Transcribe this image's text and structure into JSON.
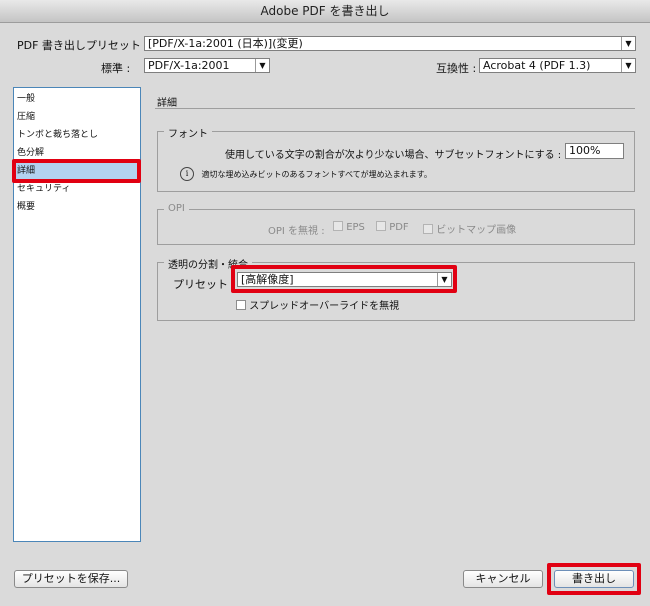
{
  "window": {
    "title": "Adobe PDF を書き出し"
  },
  "preset": {
    "label": "PDF 書き出しプリセット :",
    "value": "[PDF/X-1a:2001 (日本)](変更)"
  },
  "standard": {
    "label": "標準 :",
    "value": "PDF/X-1a:2001"
  },
  "compatibility": {
    "label": "互換性 :",
    "value": "Acrobat 4 (PDF 1.3)"
  },
  "sidebar": {
    "items": [
      {
        "label": "一般"
      },
      {
        "label": "圧縮"
      },
      {
        "label": "トンボと裁ち落とし"
      },
      {
        "label": "色分解"
      },
      {
        "label": "詳細",
        "selected": true
      },
      {
        "label": "セキュリティ"
      },
      {
        "label": "概要"
      }
    ]
  },
  "main": {
    "section_title": "詳細",
    "fonts": {
      "title": "フォント",
      "subset_label": "使用している文字の割合が次より少ない場合、サブセットフォントにする :",
      "subset_value": "100%",
      "info_icon": "i",
      "info_text": "適切な埋め込みビットのあるフォントすべてが埋め込まれます。"
    },
    "opi": {
      "title": "OPI",
      "omit_label": "OPI を無視 :",
      "options": [
        "EPS",
        "PDF",
        "ビットマップ画像"
      ]
    },
    "transparency": {
      "title": "透明の分割・統合",
      "preset_label": "プリセット :",
      "preset_value": "[高解像度]",
      "override_label": "スプレッドオーバーライドを無視"
    }
  },
  "buttons": {
    "save_preset": "プリセットを保存...",
    "cancel": "キャンセル",
    "export": "書き出し"
  },
  "colors": {
    "highlight": "#e10012",
    "selection": "#b3d2f0",
    "sidebar_border": "#4b86b8"
  }
}
